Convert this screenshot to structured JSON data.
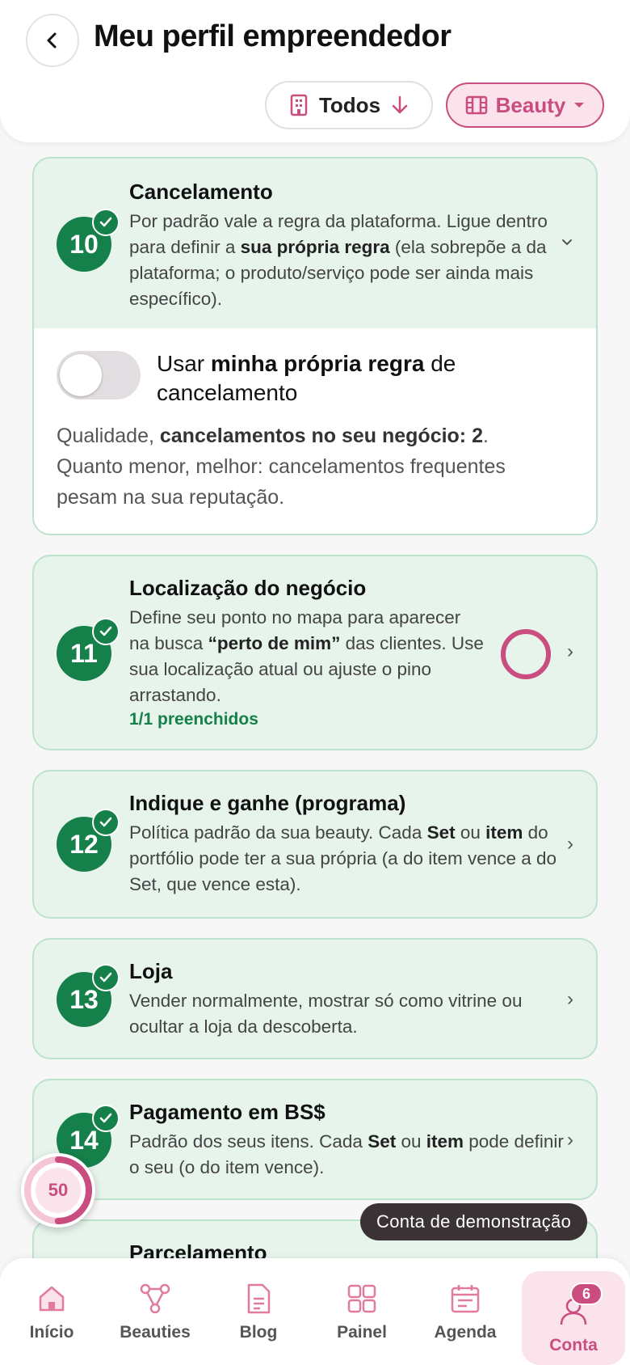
{
  "header": {
    "title": "Meu perfil empreendedor",
    "filter_all": "Todos",
    "filter_beauty": "Beauty"
  },
  "cards": [
    {
      "number": "10",
      "title": "Cancelamento",
      "desc_1": "Por padrão vale a regra da plataforma. Ligue dentro para definir a ",
      "desc_bold": "sua própria regra",
      "desc_2": " (ela sobrepõe a da plataforma; o produto/serviço pode ser ainda mais específico).",
      "toggle_pre": "Usar ",
      "toggle_bold": "minha própria regra",
      "toggle_post": " de cancelamento",
      "toggle_on": false,
      "quality_pre": "Qualidade, ",
      "quality_bold": "cancelamentos no seu negócio: 2",
      "quality_post": ". Quanto menor, melhor: cancelamentos frequentes pesam na sua reputação."
    },
    {
      "number": "11",
      "title": "Localização do negócio",
      "desc_1": "Define seu ponto no mapa para aparecer na busca ",
      "desc_bold": "“perto de mim”",
      "desc_2": " das clientes. Use sua localização atual ou ajuste o pino arrastando.",
      "sub": "1/1 preenchidos"
    },
    {
      "number": "12",
      "title": "Indique e ganhe (programa)",
      "desc_1": "Política padrão da sua beauty. Cada ",
      "desc_bold": "Set",
      "desc_mid": " ou ",
      "desc_bold2": "item",
      "desc_2": " do portfólio pode ter a sua própria (a do item vence a do Set, que vence esta)."
    },
    {
      "number": "13",
      "title": "Loja",
      "desc_1": "Vender normalmente, mostrar só como vitrine ou ocultar a loja da descoberta."
    },
    {
      "number": "14",
      "title": "Pagamento em BS$",
      "desc_1": "Padrão dos seus itens. Cada ",
      "desc_bold": "Set",
      "desc_mid": " ou ",
      "desc_bold2": "item",
      "desc_2": " pode definir o seu (o do item vence)."
    },
    {
      "title": "Parcelamento"
    }
  ],
  "progress": {
    "value": "50",
    "fraction": 0.5
  },
  "demo_label": "Conta de demonstração",
  "nav": {
    "items": [
      "Início",
      "Beauties",
      "Blog",
      "Painel",
      "Agenda",
      "Conta"
    ],
    "badge": "6"
  },
  "colors": {
    "accent": "#c94d7f",
    "success": "#15804a",
    "card_bg": "#e6f4ec"
  }
}
